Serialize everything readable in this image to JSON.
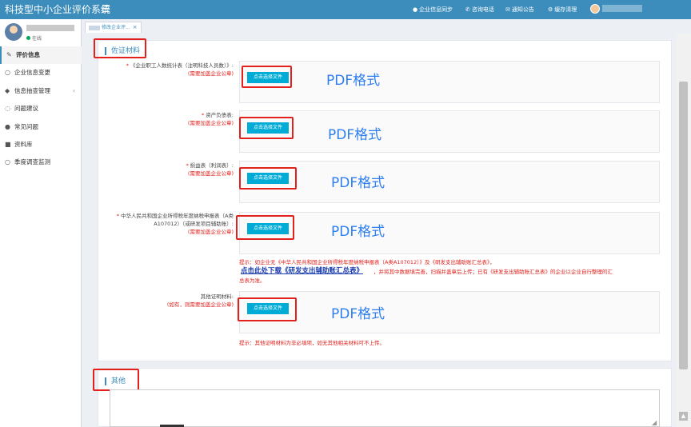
{
  "app": {
    "title": "科技型中小企业评价系统"
  },
  "topnav": [
    {
      "label": "企业信息同步",
      "icon": "user-icon"
    },
    {
      "label": "咨询电话",
      "icon": "phone-icon"
    },
    {
      "label": "通知公告",
      "icon": "bell-icon"
    },
    {
      "label": "缓存清理",
      "icon": "gear-icon"
    }
  ],
  "user": {
    "status": "在线"
  },
  "sidebar": {
    "items": [
      {
        "label": "评价信息",
        "icon": "edit-icon"
      },
      {
        "label": "企业信息变更",
        "icon": "circle-icon"
      },
      {
        "label": "信息抽查管理",
        "icon": "tag-icon"
      },
      {
        "label": "问题建议",
        "icon": "comment-icon"
      },
      {
        "label": "常见问题",
        "icon": "question-icon"
      },
      {
        "label": "资料库",
        "icon": "folder-icon"
      },
      {
        "label": "季度调查监测",
        "icon": "circle-icon"
      }
    ]
  },
  "tab": {
    "label": "修改企业评...",
    "close": "×"
  },
  "sections": {
    "evidence_title": "佐证材料",
    "other_title": "其他"
  },
  "fields": [
    {
      "star": "*",
      "label": "《企业职工人数统计表（注明科技人员数）》:",
      "req": "(需要加盖企业公章)"
    },
    {
      "star": "*",
      "label": "资产负债表:",
      "req": "(需要加盖企业公章)"
    },
    {
      "star": "*",
      "label": "损益表（利润表）:",
      "req": "(需要加盖企业公章)"
    },
    {
      "star": "*",
      "label": "中华人民共和国企业所得税年度纳税申报表（A类A107012）（或研发项目辅助账）:",
      "req": "(需要加盖企业公章)"
    },
    {
      "star": "",
      "label": "其他证明材料:",
      "req": "(如有，则需要加盖企业公章)"
    }
  ],
  "upload": {
    "button_label": "点击选择文件",
    "pdf_note": "PDF格式"
  },
  "hints": {
    "hint1_line1": "提示：如企业无《中华人民共和国企业所得税年度纳税申报表（A类A107012）》及《研发支出辅助账汇总表》，",
    "hint1_link": "点击此处下载《研发支出辅助账汇总表》",
    "hint1_line2_rest": "，并将其中数据填完善，扫描并盖章后上传；已有《研发支出辅助账汇总表》的企业以企业自行整理的汇",
    "hint1_line3": "总表为准。",
    "hint2": "提示：其他证明材料为非必填项，如无其他相关材料可不上传。"
  }
}
